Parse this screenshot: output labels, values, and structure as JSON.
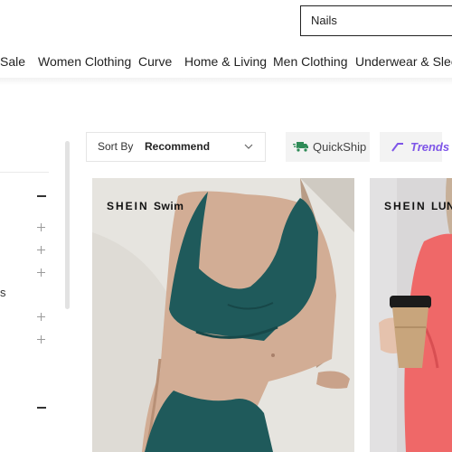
{
  "search": {
    "value": "Nails"
  },
  "nav": {
    "items": [
      {
        "label": "Sale"
      },
      {
        "label": "Women Clothing",
        "active": true
      },
      {
        "label": "Curve"
      },
      {
        "label": "Home & Living"
      },
      {
        "label": "Men Clothing"
      },
      {
        "label": "Underwear & Sleep"
      }
    ]
  },
  "toolbar": {
    "sort_label": "Sort By",
    "sort_value": "Recommend",
    "quickship_label": "QuickShip",
    "trends_label": "Trends"
  },
  "filters": {
    "partial_text": "s"
  },
  "products": [
    {
      "brand": "SHEIN",
      "sub_brand": "Swim"
    },
    {
      "brand": "SHEIN",
      "sub_brand": "LUN"
    }
  ],
  "colors": {
    "accent_trends": "#7e55e8",
    "quickship_green": "#2e8b57",
    "swimsuit_teal": "#1f5a5b"
  }
}
